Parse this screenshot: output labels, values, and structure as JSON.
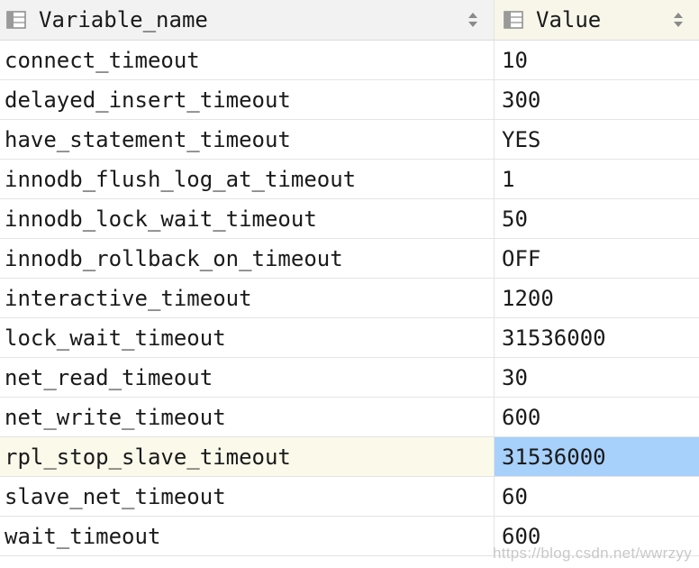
{
  "table": {
    "columns": [
      {
        "label": "Variable_name",
        "icon": "column-icon",
        "sort_icon": "sort-icon"
      },
      {
        "label": "Value",
        "icon": "column-icon",
        "sort_icon": "sort-icon"
      }
    ],
    "rows": [
      {
        "name": "connect_timeout",
        "value": "10"
      },
      {
        "name": "delayed_insert_timeout",
        "value": "300"
      },
      {
        "name": "have_statement_timeout",
        "value": "YES"
      },
      {
        "name": "innodb_flush_log_at_timeout",
        "value": "1"
      },
      {
        "name": "innodb_lock_wait_timeout",
        "value": "50"
      },
      {
        "name": "innodb_rollback_on_timeout",
        "value": "OFF"
      },
      {
        "name": "interactive_timeout",
        "value": "1200"
      },
      {
        "name": "lock_wait_timeout",
        "value": "31536000"
      },
      {
        "name": "net_read_timeout",
        "value": "30"
      },
      {
        "name": "net_write_timeout",
        "value": "600"
      },
      {
        "name": "rpl_stop_slave_timeout",
        "value": "31536000",
        "selected": true
      },
      {
        "name": "slave_net_timeout",
        "value": "60"
      },
      {
        "name": "wait_timeout",
        "value": "600"
      }
    ]
  },
  "watermark": "https://blog.csdn.net/wwrzyy",
  "colors": {
    "header_bg": "#f2f2f2",
    "value_header_bg": "#f7f6e9",
    "selected_row_bg": "#fbf9ea",
    "selected_cell_bg": "#a7d0fb",
    "grid_line": "#e4e4e4"
  }
}
